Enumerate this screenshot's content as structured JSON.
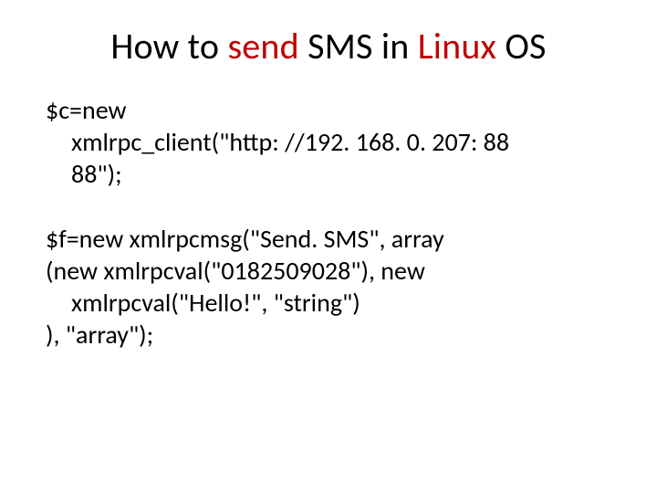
{
  "title": {
    "t1": "How to ",
    "t2": "send",
    "t3": " SMS in ",
    "t4": "Linux",
    "t5": " OS"
  },
  "code1": {
    "l1": "$c=new",
    "l2": "xmlrpc_client(\"http: //192. 168. 0. 207: 88",
    "l3": "88\");"
  },
  "code2": {
    "l1": "$f=new xmlrpcmsg(\"Send. SMS\", array",
    "l2": "(new xmlrpcval(\"0182509028\"), new",
    "l3": "xmlrpcval(\"Hello!\", \"string\")",
    "l4": "), \"array\");"
  }
}
